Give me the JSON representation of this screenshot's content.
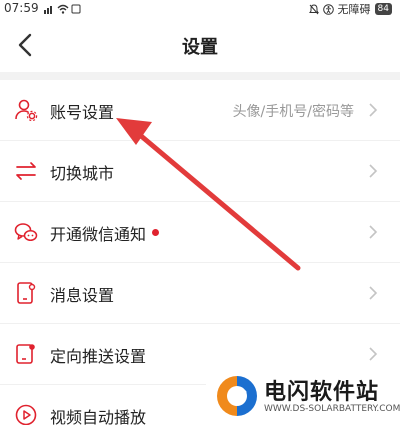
{
  "status_bar": {
    "time": "07:59",
    "accessibility": "无障碍",
    "battery": "84"
  },
  "header": {
    "title": "设置"
  },
  "settings": {
    "items": [
      {
        "label": "账号设置",
        "detail": "头像/手机号/密码等",
        "icon": "account-settings-icon"
      },
      {
        "label": "切换城市",
        "icon": "switch-city-icon"
      },
      {
        "label": "开通微信通知",
        "icon": "wechat-icon",
        "badge": "red-dot"
      },
      {
        "label": "消息设置",
        "icon": "message-settings-icon"
      },
      {
        "label": "定向推送设置",
        "icon": "push-settings-icon"
      },
      {
        "label": "视频自动播放",
        "icon": "video-play-icon"
      }
    ]
  },
  "watermark": {
    "title": "电闪软件站",
    "url": "WWW.DS-SOLARBATTERY.COM"
  },
  "colors": {
    "accent": "#e0222e",
    "background": "#f2f2f2"
  }
}
